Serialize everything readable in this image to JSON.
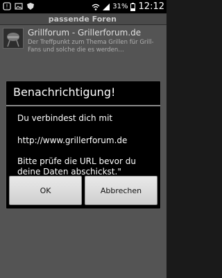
{
  "status_bar": {
    "battery": "31%",
    "time": "12:12",
    "icons": [
      "notification-icon",
      "image-icon",
      "shield-icon",
      "wifi-icon",
      "signal-icon",
      "battery-icon"
    ]
  },
  "header": {
    "title": "passende Foren"
  },
  "list": {
    "items": [
      {
        "title": "Grillforum - Grillerforum.de",
        "desc": "Der Treffpunkt zum Thema Grillen für Grill-Fans und solche die es werden…"
      }
    ]
  },
  "dialog": {
    "title": "Benachrichtigung!",
    "message1": "Du verbindest dich mit",
    "message2": "http://www.grillerforum.de",
    "message3": "Bitte prüfe die URL bevor du deine Daten abschickst.\"",
    "ok_label": "OK",
    "cancel_label": "Abbrechen"
  },
  "colors": {
    "dialog_bg": "#000000",
    "overlay": "#545454",
    "button": "#dcdcdc"
  }
}
